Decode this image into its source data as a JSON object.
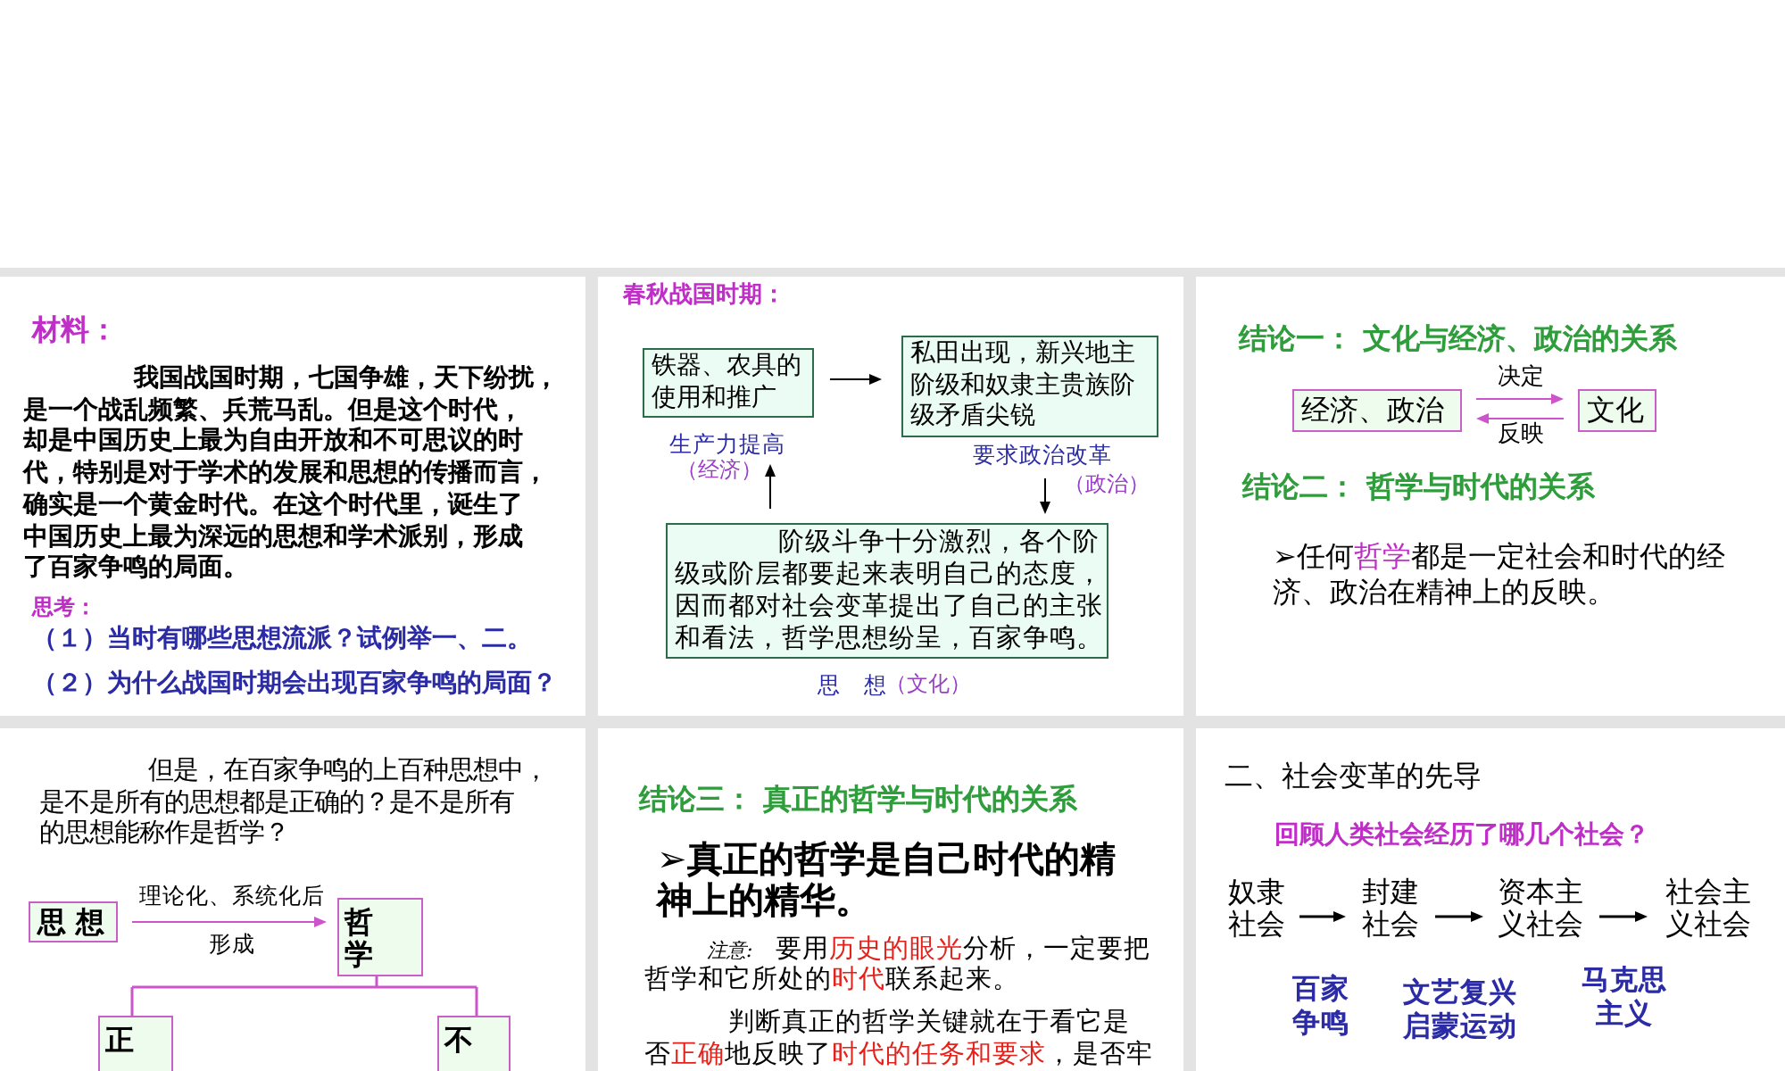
{
  "slides": [
    {
      "kind": "material",
      "heading": "材料：",
      "lines": [
        "我国战国时期，七国争雄，天下纷扰，",
        "是一个战乱频繁、兵荒马乱。但是这个时代，",
        "却是中国历史上最为自由开放和不可思议的时",
        "代，特别是对于学术的发展和思想的传播而言，",
        "确实是一个黄金时代。在这个时代里，诞生了",
        "中国历史上最为深远的思想和学术派别，形成",
        "了百家争鸣的局面。"
      ],
      "prompt": "思考：",
      "questions": [
        "（１）当时有哪些思想流派？试例举一、二。",
        "（２）为什么战国时期会出现百家争鸣的局面？"
      ]
    },
    {
      "kind": "causes",
      "heading": "春秋战国时期：",
      "boxes": [
        {
          "lines": [
            "铁器、农具的",
            "使用和推广"
          ]
        },
        {
          "lines": [
            "私田出现，新兴地主",
            "阶级和奴隶主贵族阶",
            "级矛盾尖锐"
          ]
        },
        {
          "lines": [
            "阶级斗争十分激烈，各个阶",
            "级或阶层都要起来表明自己的态度，",
            "因而都对社会变革提出了自己的主张",
            "和看法，哲学思想纷呈，百家争鸣。"
          ]
        }
      ],
      "labels": [
        {
          "text": "生产力提高",
          "note": "（经济）"
        },
        {
          "text": "要求政治改革",
          "note": "（政治）"
        },
        {
          "text": "思　想",
          "note": "（文化）"
        }
      ]
    },
    {
      "kind": "relations",
      "heading": "结论一： 文化与经济、政治的关系",
      "relation": {
        "source": "经济、政治",
        "target": "文化",
        "forward": "决定",
        "backward": "反映"
      },
      "subheading": "结论二： 哲学与时代的关系",
      "bullet": {
        "lines": [
          {
            "segments": [
              {
                "text": "➢任何",
                "emphasis": false
              },
              {
                "text": "哲学",
                "emphasis": true
              },
              {
                "text": "都是一定社会和时代的经",
                "emphasis": false
              }
            ]
          },
          {
            "segments": [
              {
                "text": "济、政治在精神上的反映。",
                "emphasis": false
              }
            ]
          }
        ]
      }
    },
    {
      "kind": "question_tree",
      "lines": [
        "但是，在百家争鸣的上百种思想中，",
        "是不是所有的思想都是正确的？是不是所有",
        "的思想能称作是哲学？"
      ],
      "tree": {
        "source": "思 想",
        "above_arrow": "理论化、系统化后",
        "below_arrow": "形成",
        "result": "哲学",
        "branches": [
          "正",
          "不"
        ]
      }
    },
    {
      "kind": "conclusion",
      "heading": "结论三： 真正的哲学与时代的关系",
      "statement": [
        "➢真正的哲学是自己时代的精",
        "神上的精华。"
      ],
      "note": {
        "label": "注意:",
        "lines": [
          {
            "segments": [
              {
                "text": "要用",
                "emphasis": false
              },
              {
                "text": "历史的眼光",
                "emphasis": true
              },
              {
                "text": "分析，一定要把",
                "emphasis": false
              }
            ]
          },
          {
            "segments": [
              {
                "text": "哲学和它所处的",
                "emphasis": false
              },
              {
                "text": "时代",
                "emphasis": true
              },
              {
                "text": "联系起来。",
                "emphasis": false
              }
            ]
          }
        ]
      },
      "judgement": {
        "lines": [
          {
            "segments": [
              {
                "text": "判断真正的哲学关键就在于看它是",
                "emphasis": false
              }
            ]
          },
          {
            "segments": [
              {
                "text": "否",
                "emphasis": false
              },
              {
                "text": "正确",
                "emphasis": true
              },
              {
                "text": "地反映了",
                "emphasis": false
              },
              {
                "text": "时代的任务和要求",
                "emphasis": true
              },
              {
                "text": "，是否牢",
                "emphasis": false
              }
            ]
          }
        ]
      }
    },
    {
      "kind": "timeline",
      "heading": "二、社会变革的先导",
      "question": "回顾人类社会经历了哪几个社会？",
      "stages": [
        {
          "lines": [
            "奴隶",
            "社会"
          ]
        },
        {
          "lines": [
            "封建",
            "社会"
          ]
        },
        {
          "lines": [
            "资本主",
            "义社会"
          ]
        },
        {
          "lines": [
            "社会主",
            "义社会"
          ]
        }
      ],
      "movements": [
        {
          "lines": [
            "百家",
            "争鸣"
          ]
        },
        {
          "lines": [
            "文艺复兴",
            "启蒙运动"
          ]
        },
        {
          "lines": [
            "马克思",
            "主义"
          ]
        }
      ]
    }
  ]
}
